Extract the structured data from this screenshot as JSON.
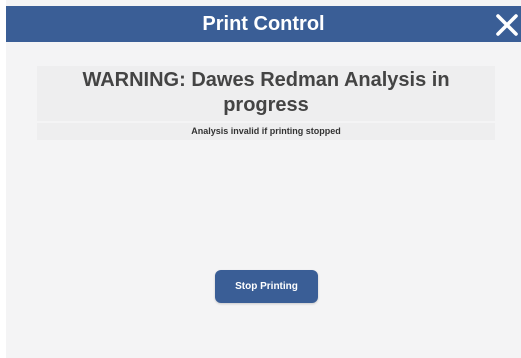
{
  "window": {
    "title": "Print Control"
  },
  "warning": {
    "title": "WARNING: Dawes Redman Analysis in progress",
    "subtitle": "Analysis invalid if printing stopped"
  },
  "actions": {
    "stop_printing_label": "Stop Printing"
  },
  "icons": {
    "close": "close-icon"
  },
  "colors": {
    "accent": "#3a5e96",
    "background": "#f4f4f5",
    "panel": "#eeeeef",
    "title_text": "#ffffff",
    "body_text": "#444444"
  }
}
